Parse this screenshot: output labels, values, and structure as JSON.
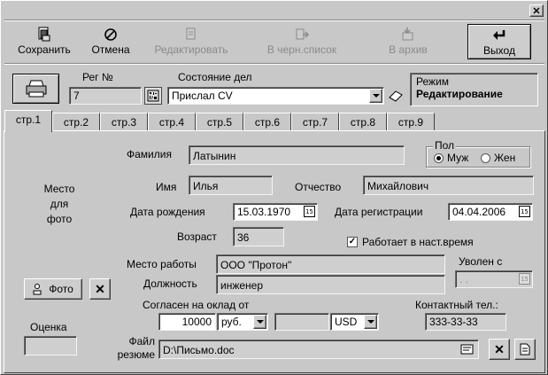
{
  "toolbar": {
    "save": "Сохранить",
    "cancel": "Отмена",
    "edit": "Редактировать",
    "blacklist": "В черн.список",
    "archive": "В архив",
    "exit": "Выход"
  },
  "header": {
    "reg_label": "Рег №",
    "reg_value": "7",
    "state_label": "Состояние дел",
    "state_value": "Прислал CV",
    "mode_label": "Режим",
    "mode_value": "Редактирование"
  },
  "tabs": [
    "стр.1",
    "стр.2",
    "стр.3",
    "стр.4",
    "стр.5",
    "стр.6",
    "стр.7",
    "стр.8",
    "стр.9"
  ],
  "form": {
    "photo_placeholder": "Место\nдля\nфото",
    "surname_label": "Фамилия",
    "surname": "Латынин",
    "sex_label": "Пол",
    "male": "Муж",
    "female": "Жен",
    "name_label": "Имя",
    "name": "Илья",
    "patronymic_label": "Отчество",
    "patronymic": "Михайлович",
    "birth_label": "Дата рождения",
    "birth": "15.03.1970",
    "reg_date_label": "Дата регистрации",
    "reg_date": "04.04.2006",
    "age_label": "Возраст",
    "age": "36",
    "working_now": "Работает в наст.время",
    "workplace_label": "Место работы",
    "workplace": "ООО \"Протон\"",
    "fired_label": "Уволен с",
    "fired_value": " .  .",
    "position_label": "Должность",
    "position": "инженер",
    "photo_btn": "Фото",
    "salary_label": "Согласен на оклад от",
    "salary": "10000",
    "currency1": "руб.",
    "amount2": "",
    "currency2": "USD",
    "phone_label": "Контактный тел.:",
    "phone": "333-33-33",
    "rating_label": "Оценка",
    "rating": "",
    "resume_label": "Файл\nрезюме",
    "resume": "D:\\Письмо.doc"
  }
}
